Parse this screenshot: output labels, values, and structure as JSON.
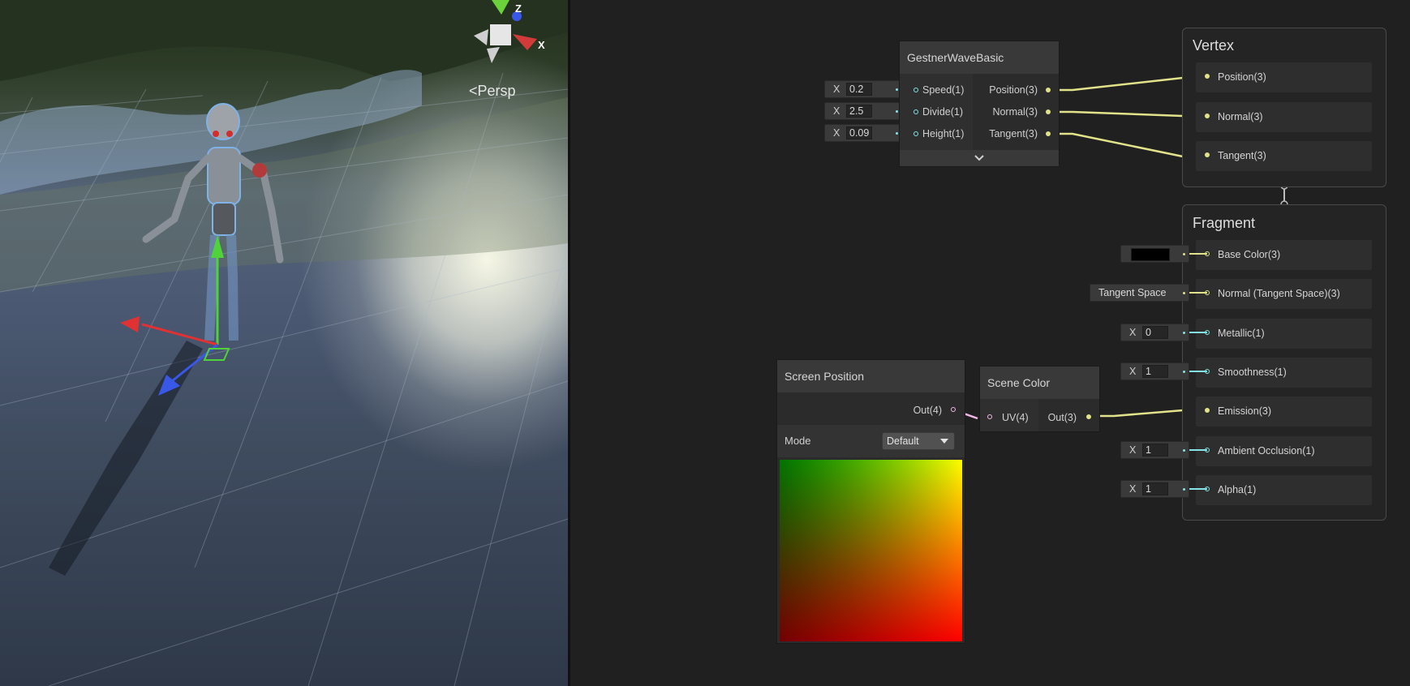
{
  "scene_view": {
    "camera_label": "Persp",
    "gizmo_axes": {
      "z": "Z",
      "x": "X"
    }
  },
  "nodes": {
    "gestner": {
      "title": "GestnerWaveBasic",
      "inputs": [
        {
          "label": "Speed(1)",
          "x_label": "X",
          "value": "0.2"
        },
        {
          "label": "Divide(1)",
          "x_label": "X",
          "value": "2.5"
        },
        {
          "label": "Height(1)",
          "x_label": "X",
          "value": "0.09"
        }
      ],
      "outputs": [
        "Position(3)",
        "Normal(3)",
        "Tangent(3)"
      ],
      "expand_icon": "chevron-down-icon"
    },
    "screen_position": {
      "title": "Screen Position",
      "output": "Out(4)",
      "mode_label": "Mode",
      "mode_value": "Default"
    },
    "scene_color": {
      "title": "Scene Color",
      "input": "UV(4)",
      "output": "Out(3)"
    }
  },
  "master": {
    "vertex": {
      "title": "Vertex",
      "blocks": [
        "Position(3)",
        "Normal(3)",
        "Tangent(3)"
      ]
    },
    "fragment": {
      "title": "Fragment",
      "blocks": [
        "Base Color(3)",
        "Normal (Tangent Space)(3)",
        "Metallic(1)",
        "Smoothness(1)",
        "Emission(3)",
        "Ambient Occlusion(1)",
        "Alpha(1)"
      ],
      "base_color_swatch": "#000000",
      "normal_space_label": "Tangent Space",
      "fields": {
        "metallic": {
          "x_label": "X",
          "value": "0"
        },
        "smoothness": {
          "x_label": "X",
          "value": "1"
        },
        "ambient_occlusion": {
          "x_label": "X",
          "value": "1"
        },
        "alpha": {
          "x_label": "X",
          "value": "1"
        }
      }
    }
  },
  "colors": {
    "vector3_port": "#e2e28a",
    "float_port": "#84e4e7",
    "vector4_port": "#f0b8e6",
    "graph_bg": "#202020"
  }
}
